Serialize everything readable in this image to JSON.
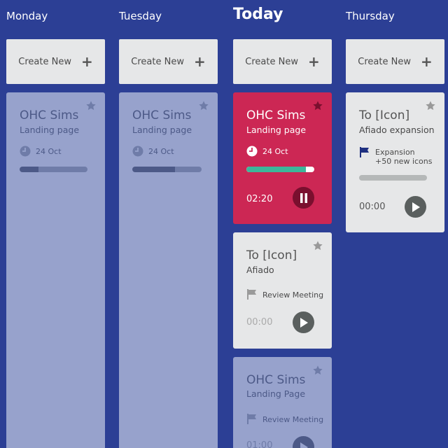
{
  "columns": {
    "monday": {
      "title": "Monday",
      "create_label": "Create New",
      "card": {
        "title": "OHC Sims",
        "subtitle": "Landing page",
        "date": "24 Oct",
        "progress": 0.28
      }
    },
    "tuesday": {
      "title": "Tuesday",
      "create_label": "Create New",
      "card": {
        "title": "OHC Sims",
        "subtitle": "Landing page",
        "date": "24 Oct",
        "progress": 0.62
      }
    },
    "today": {
      "title": "Today",
      "create_label": "Create New",
      "cards": [
        {
          "title": "OHC Sims",
          "subtitle": "Landing page",
          "date": "24 Oct",
          "progress": 0.88,
          "time": "02:20"
        },
        {
          "title": "To [Icon]",
          "subtitle": "Afiado",
          "flag_text": "Review Meeting",
          "time": "00:00"
        },
        {
          "title": "OHC Sims",
          "subtitle": "Landing Page",
          "flag_text": "Review Meeting",
          "time": "01:00"
        }
      ]
    },
    "thursday": {
      "title": "Thursday",
      "create_label": "Create New",
      "card": {
        "title": "To [Icon]",
        "subtitle": "Afiado expansion",
        "flag_line1": "Expansion",
        "flag_line2": "+50 new icons",
        "time": "00:00"
      }
    }
  },
  "colors": {
    "background": "#2c3f95",
    "active_card": "#cc2754",
    "progress_active": "#3db79a",
    "faded_card": "#97a2cc"
  }
}
